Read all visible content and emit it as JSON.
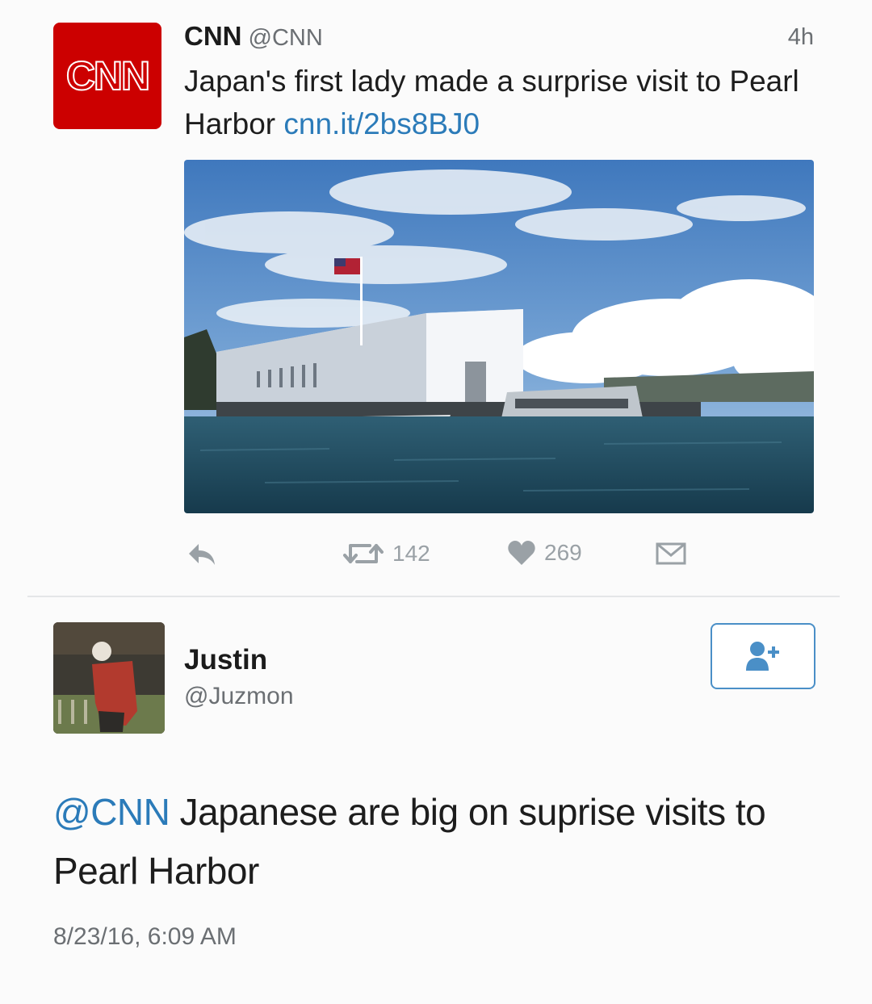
{
  "tweet": {
    "logo_text": "CNN",
    "author_name": "CNN",
    "author_handle": "@CNN",
    "time": "4h",
    "text": "Japan's first lady made a surprise visit to Pearl Harbor",
    "link": "cnn.it/2bs8BJ0",
    "image_alt": "Pearl Harbor memorial photo",
    "actions": {
      "reply_icon": "reply-icon",
      "retweet_icon": "retweet-icon",
      "retweet_count": "142",
      "like_icon": "heart-icon",
      "like_count": "269",
      "dm_icon": "envelope-icon"
    }
  },
  "reply": {
    "name": "Justin",
    "handle": "@Juzmon",
    "mention": "@CNN",
    "text": " Japanese are big on suprise visits to Pearl Harbor",
    "timestamp": "8/23/16, 6:09 AM",
    "follow_icon": "add-user-icon"
  },
  "colors": {
    "brand_red": "#cc0000",
    "link_blue": "#2b7bb9",
    "muted_gray": "#6b6f73",
    "icon_gray": "#9aa1a6"
  }
}
